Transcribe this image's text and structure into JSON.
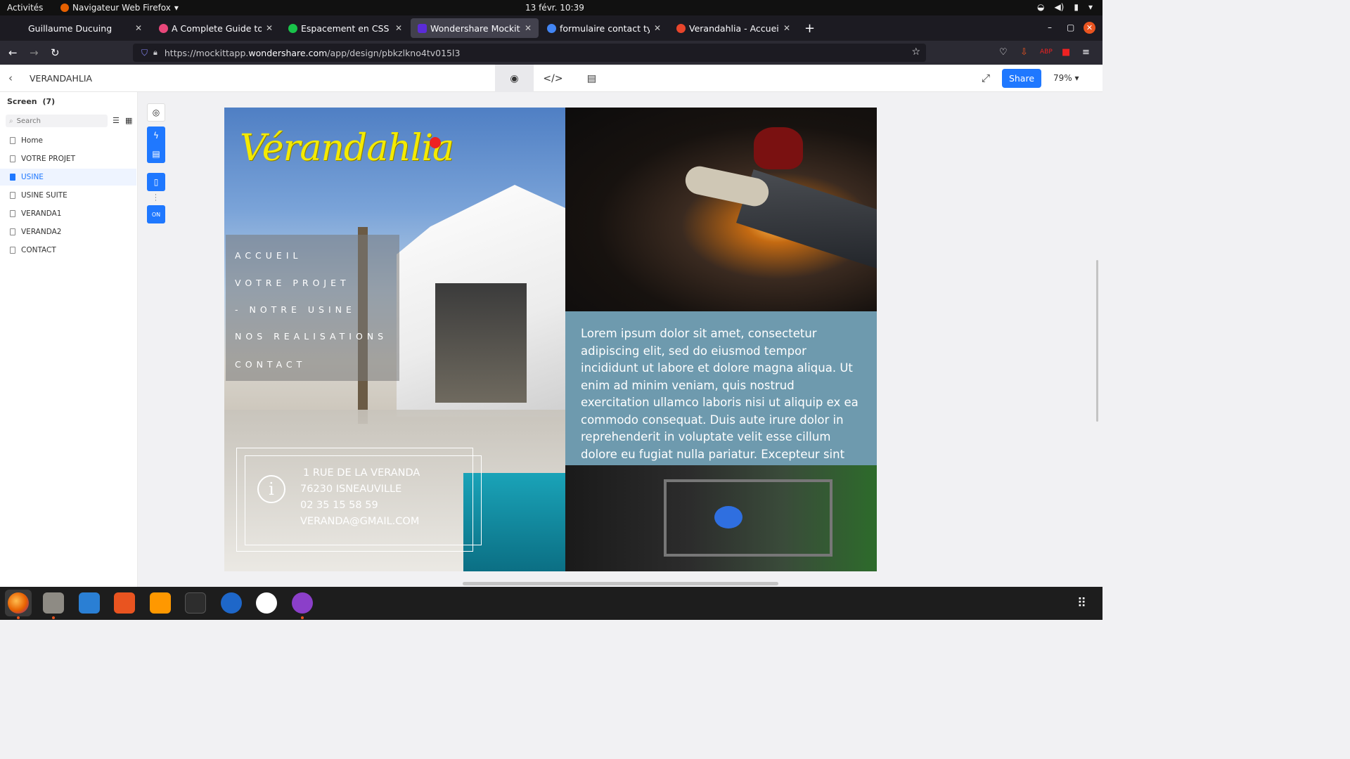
{
  "system": {
    "activities": "Activités",
    "app_menu": "Navigateur Web Firefox",
    "datetime": "13 févr.  10:39",
    "battery_icon": "battery-icon",
    "volume_icon": "volume-icon",
    "wifi_icon": "wifi-icon"
  },
  "browser": {
    "tabs": [
      {
        "title": "Guillaume Ducuing",
        "favicon": "#4a90e2"
      },
      {
        "title": "A Complete Guide to Flex",
        "favicon": "#e8477a"
      },
      {
        "title": "Espacement en CSS (padd",
        "favicon": "#19c34a"
      },
      {
        "title": "Wondershare Mockitt - V",
        "favicon": "#5b2bd8"
      },
      {
        "title": "formulaire contact type - ",
        "favicon": "#4285f4"
      },
      {
        "title": "Verandahlia - Accueil",
        "favicon": "#e8452b"
      }
    ],
    "url_host_prefix": "https://mockittapp.",
    "url_host": "wondershare.com",
    "url_path": "/app/design/pbkzlkno4tv015l3"
  },
  "mockitt": {
    "project_name": "VERANDAHLIA",
    "share_label": "Share",
    "zoom_label": "79%",
    "screen_title": "Screen",
    "screen_count": "(7)",
    "search_placeholder": "Search",
    "pages": [
      "Home",
      "VOTRE PROJET",
      "USINE",
      "USINE SUITE",
      "VERANDA1",
      "VERANDA2",
      "CONTACT"
    ],
    "selected_page": "USINE"
  },
  "design": {
    "logo": "Vérandahlia",
    "menu": [
      "ACCUEIL",
      "VOTRE PROJET",
      "- NOTRE USINE",
      "NOS REALISATIONS",
      "CONTACT"
    ],
    "info_icon_glyph": "i",
    "address": [
      "1 RUE DE LA VERANDA",
      "76230 ISNEAUVILLE",
      "02 35 15 58 59",
      "VERANDA@GMAIL.COM"
    ],
    "lorem": "Lorem ipsum dolor sit amet, consectetur adipiscing elit, sed do eiusmod tempor incididunt ut labore et dolore magna aliqua. Ut enim ad minim veniam, quis nostrud exercitation ullamco laboris nisi ut aliquip ex ea commodo consequat. Duis aute irure dolor in reprehenderit in voluptate velit esse cillum dolore eu fugiat nulla pariatur. Excepteur sint occaecat cupidatat non proident,"
  },
  "colors": {
    "accent": "#1f78ff",
    "logo_yellow": "#f4ea00",
    "lorem_bg": "#6e9aae",
    "ubuntu_orange": "#e95420"
  }
}
